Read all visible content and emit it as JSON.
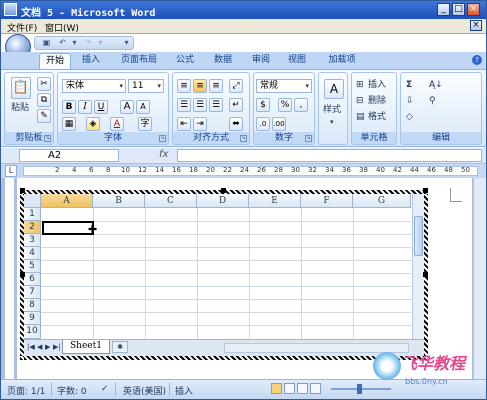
{
  "titlebar": {
    "title": "文档 5 - Microsoft Word"
  },
  "menubar": {
    "items": [
      "文件(F)",
      "窗口(W)"
    ]
  },
  "tabs": [
    "开始",
    "插入",
    "页面布局",
    "公式",
    "数据",
    "审阅",
    "视图",
    "加载项"
  ],
  "ribbon": {
    "clipboard": {
      "paste_label": "粘贴",
      "group_label": "剪贴板"
    },
    "font": {
      "font_name": "宋体",
      "font_size": "11",
      "bold": "B",
      "italic": "I",
      "underline": "U",
      "grow": "A",
      "shrink": "A",
      "font_color": "A",
      "group_label": "字体"
    },
    "alignment": {
      "group_label": "对齐方式"
    },
    "number": {
      "format": "常规",
      "percent": "%",
      "comma": ",",
      "group_label": "数字"
    },
    "styles": {
      "label": "样式"
    },
    "cells": {
      "insert": "插入",
      "delete": "删除",
      "format": "格式",
      "group_label": "单元格"
    },
    "editing": {
      "sigma": "Σ",
      "group_label": "编辑"
    }
  },
  "formulabar": {
    "name_box": "A2",
    "fx": "fx"
  },
  "ruler": {
    "labels": [
      "2",
      "4",
      "6",
      "8",
      "10",
      "12",
      "14",
      "16",
      "18",
      "20",
      "22",
      "24",
      "26",
      "28",
      "30",
      "32",
      "34",
      "36",
      "38",
      "40",
      "42",
      "44",
      "46",
      "48"
    ],
    "end_label": "50"
  },
  "sheet": {
    "columns": [
      "A",
      "B",
      "C",
      "D",
      "E",
      "F",
      "G"
    ],
    "rows": [
      "1",
      "2",
      "3",
      "4",
      "5",
      "6",
      "7",
      "8",
      "9",
      "10"
    ],
    "active_column": "A",
    "active_row": "2",
    "tab_name": "Sheet1"
  },
  "statusbar": {
    "page": "页面: 1/1",
    "words": "字数: 0",
    "language": "英语(美国)",
    "mode": "插入"
  },
  "watermark": {
    "text": "飞华教程",
    "url": "bbs.0ny.cn"
  }
}
